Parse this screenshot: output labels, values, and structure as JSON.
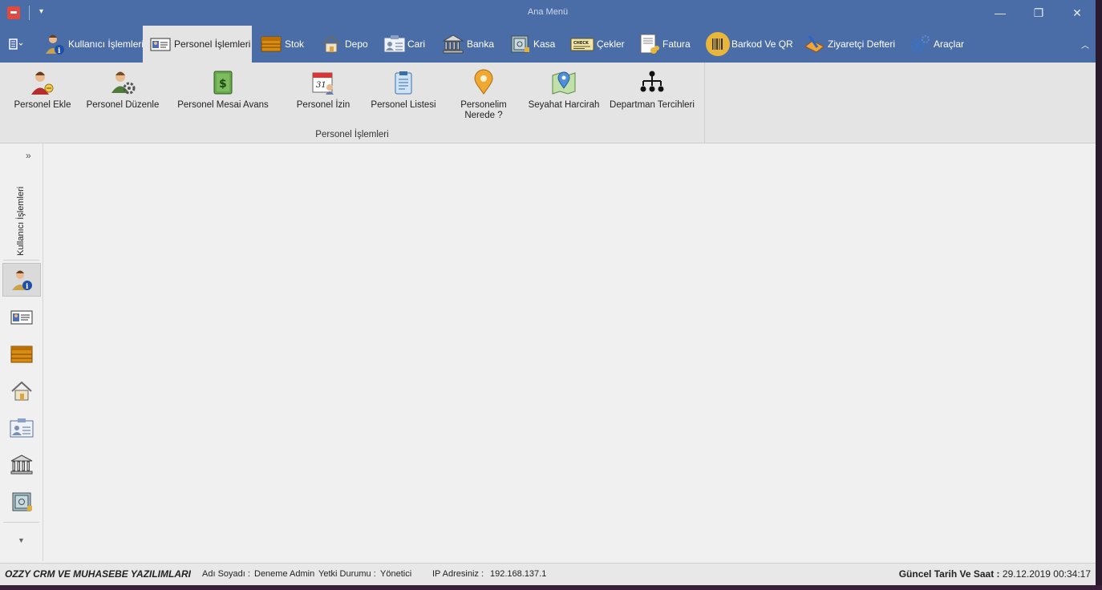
{
  "window": {
    "title": "Ana Menü"
  },
  "tabs": [
    {
      "label": "Kullanıcı İşlemleri",
      "icon": "user-info-icon"
    },
    {
      "label": "Personel İşlemleri",
      "icon": "id-card-icon"
    },
    {
      "label": "Stok",
      "icon": "box-icon"
    },
    {
      "label": "Depo",
      "icon": "house-icon"
    },
    {
      "label": "Cari",
      "icon": "contact-card-icon"
    },
    {
      "label": "Banka",
      "icon": "bank-icon"
    },
    {
      "label": "Kasa",
      "icon": "safe-icon"
    },
    {
      "label": "Çekler",
      "icon": "check-icon"
    },
    {
      "label": "Fatura",
      "icon": "invoice-icon"
    },
    {
      "label": "Barkod Ve QR",
      "icon": "barcode-icon"
    },
    {
      "label": "Ziyaretçi Defteri",
      "icon": "guestbook-icon"
    },
    {
      "label": "Araçlar",
      "icon": "gears-icon"
    }
  ],
  "ribbon": {
    "group_label": "Personel İşlemleri",
    "buttons": [
      {
        "label": "Personel Ekle",
        "icon": "add-user-icon"
      },
      {
        "label": "Personel Düzenle",
        "icon": "edit-user-icon"
      },
      {
        "label": "Personel Mesai Avans",
        "icon": "money-icon"
      },
      {
        "label": "Personel İzin",
        "icon": "calendar-icon"
      },
      {
        "label": "Personel Listesi",
        "icon": "clipboard-icon"
      },
      {
        "label": "Personelim\nNerede ?",
        "icon": "location-pin-icon"
      },
      {
        "label": "Seyahat Harcirah",
        "icon": "map-icon"
      },
      {
        "label": "Departman Tercihleri",
        "icon": "org-chart-icon"
      }
    ]
  },
  "nav": {
    "vertical_label": "Kullanıcı İşlemleri",
    "items": [
      "user-info-icon",
      "id-card-icon",
      "box-icon",
      "house-icon",
      "contact-card-icon",
      "bank-icon",
      "safe-icon"
    ]
  },
  "status": {
    "company": "OZZY CRM VE MUHASEBE YAZILIMLARI",
    "name_label": "Adı Soyadı :",
    "name_value": "Deneme Admin",
    "role_label": "Yetki Durumu :",
    "role_value": "Yönetici",
    "ip_label": "IP Adresiniz :",
    "ip_value": "192.168.137.1",
    "datetime_label": "Güncel Tarih Ve Saat :",
    "datetime_value": "29.12.2019 00:34:17"
  },
  "colors": {
    "accent": "#4a6da7",
    "ribbon_bg": "#e4e4e4"
  }
}
